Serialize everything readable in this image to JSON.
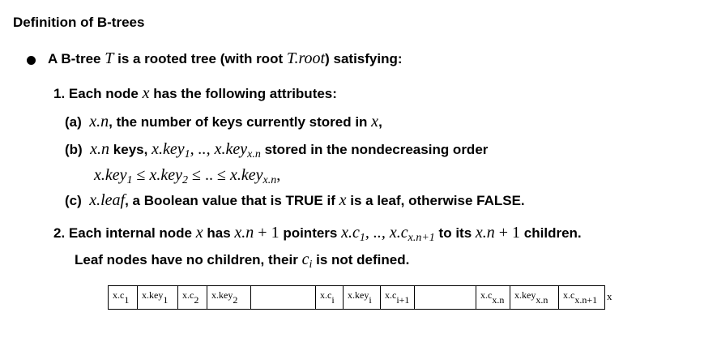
{
  "title": "Definition of B-trees",
  "bullet": {
    "prefix": "A B-tree",
    "tree_var": "T",
    "mid": "is a rooted tree (with root",
    "root": "T.root",
    "suffix": ") satisfying:"
  },
  "item1": {
    "number": "1.",
    "pre": "Each node",
    "var": "x",
    "post": "has the following attributes:"
  },
  "item1a": {
    "label": "(a)",
    "math": "x.n",
    "text": ", the number of keys currently stored in",
    "var": "x",
    "end": ","
  },
  "item1b": {
    "label": "(b)",
    "math1": "x.n",
    "text1": "keys,",
    "math2_pre": "x.key",
    "math2_sub1": "1",
    "math2_mid": ", .., x.key",
    "math2_sub2": "x.n",
    "text2": "stored in the nondecreasing order",
    "order_a": "x.key",
    "order_a_sub": "1",
    "order_le1": " ≤ ",
    "order_b": "x.key",
    "order_b_sub": "2",
    "order_le2": " ≤ .. ≤ ",
    "order_c": "x.key",
    "order_c_sub": "x.n",
    "order_end": ","
  },
  "item1c": {
    "label": "(c)",
    "math": "x.leaf",
    "text1": ", a Boolean value that is TRUE if",
    "var": "x",
    "text2": "is a leaf, otherwise FALSE."
  },
  "item2": {
    "number": "2.",
    "pre": "Each internal node",
    "var": "x",
    "has": "has",
    "count1": "x.n + 1",
    "pointers": "pointers",
    "ptr_a": "x.c",
    "ptr_a_sub": "1",
    "ptr_mid": ", .., x.c",
    "ptr_b_sub": "x.n+1",
    "to": "to its",
    "count2": "x.n + 1",
    "children": "children."
  },
  "item2_cont": {
    "pre": "Leaf nodes have no children, their",
    "var": "c",
    "var_sub": "i",
    "post": "is not defined."
  },
  "node_cells": [
    {
      "main": "x.c",
      "sub": "1",
      "width": 36
    },
    {
      "main": "x.key",
      "sub": "1",
      "width": 50
    },
    {
      "main": "x.c",
      "sub": "2",
      "width": 36
    },
    {
      "main": "x.key",
      "sub": "2",
      "width": 54
    },
    {
      "main": "",
      "sub": "",
      "width": 80
    },
    {
      "main": "x.c",
      "sub": "i",
      "width": 34
    },
    {
      "main": "x.key",
      "sub": "i",
      "width": 46
    },
    {
      "main": "x.c",
      "sub": "i+1",
      "width": 42
    },
    {
      "main": "",
      "sub": "",
      "width": 76
    },
    {
      "main": "x.c",
      "sub": "x.n",
      "width": 42
    },
    {
      "main": "x.key",
      "sub": "x.n",
      "width": 60
    },
    {
      "main": "x.c",
      "sub": "x.n+1",
      "width": 56
    }
  ],
  "node_label": "x"
}
